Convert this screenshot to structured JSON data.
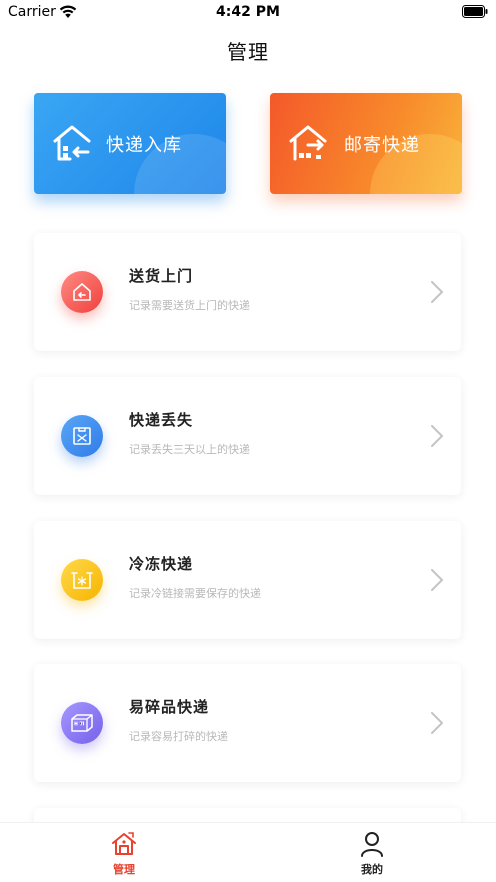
{
  "status_bar": {
    "carrier": "Carrier",
    "time": "4:42 PM"
  },
  "header": {
    "title": "管理"
  },
  "actions": {
    "inbound_label": "快递入库",
    "mail_label": "邮寄快递"
  },
  "items": [
    {
      "title": "送货上门",
      "subtitle": "记录需要送货上门的快递",
      "icon": "house-delivery-icon",
      "color": "#f0413c"
    },
    {
      "title": "快递丢失",
      "subtitle": "记录丢失三天以上的快递",
      "icon": "lost-package-icon",
      "color": "#2f7ce9"
    },
    {
      "title": "冷冻快递",
      "subtitle": "记录冷链接需要保存的快递",
      "icon": "frozen-box-icon",
      "color": "#f6b400"
    },
    {
      "title": "易碎品快递",
      "subtitle": "记录容易打碎的快递",
      "icon": "fragile-box-icon",
      "color": "#7561ea"
    }
  ],
  "tabs": {
    "manage_label": "管理",
    "mine_label": "我的"
  },
  "colors": {
    "accent_red": "#e8422e",
    "inbound_blue": "#1e86ea",
    "mail_orange": "#f4592a"
  }
}
